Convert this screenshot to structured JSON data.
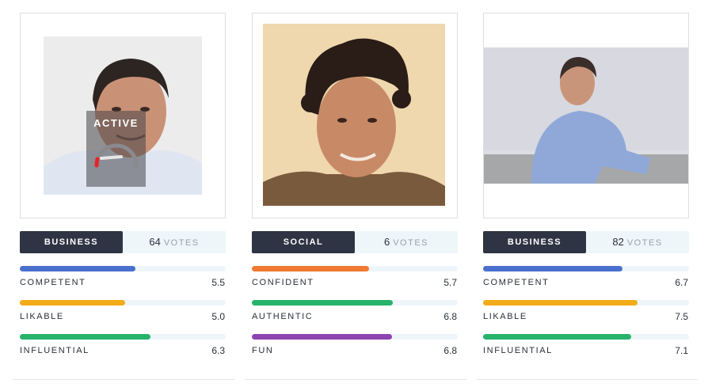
{
  "colors": {
    "badge_bg": "#2f3444",
    "track_bg": "#eef6fa",
    "competent": "#4a6fcf",
    "likable": "#f2ac18",
    "influential": "#27b36b",
    "confident": "#f07a32",
    "authentic": "#27b36b",
    "fun": "#8e44b0",
    "gauge_needle": "#e8232b"
  },
  "cards": [
    {
      "overlay": {
        "label": "ACTIVE",
        "icon": "gauge-icon"
      },
      "category": "BUSINESS",
      "votes_count": "64",
      "votes_label": "VOTES",
      "traits": [
        {
          "name": "COMPETENT",
          "score": "5.5",
          "fraction": 0.56,
          "color": "#4a6fcf"
        },
        {
          "name": "LIKABLE",
          "score": "5.0",
          "fraction": 0.51,
          "color": "#f2ac18"
        },
        {
          "name": "INFLUENTIAL",
          "score": "6.3",
          "fraction": 0.635,
          "color": "#27b36b"
        }
      ]
    },
    {
      "category": "SOCIAL",
      "votes_count": "6",
      "votes_label": "VOTES",
      "traits": [
        {
          "name": "CONFIDENT",
          "score": "5.7",
          "fraction": 0.57,
          "color": "#f07a32"
        },
        {
          "name": "AUTHENTIC",
          "score": "6.8",
          "fraction": 0.685,
          "color": "#27b36b"
        },
        {
          "name": "FUN",
          "score": "6.8",
          "fraction": 0.68,
          "color": "#8e44b0"
        }
      ]
    },
    {
      "category": "BUSINESS",
      "votes_count": "82",
      "votes_label": "VOTES",
      "traits": [
        {
          "name": "COMPETENT",
          "score": "6.7",
          "fraction": 0.675,
          "color": "#4a6fcf"
        },
        {
          "name": "LIKABLE",
          "score": "7.5",
          "fraction": 0.75,
          "color": "#f2ac18"
        },
        {
          "name": "INFLUENTIAL",
          "score": "7.1",
          "fraction": 0.72,
          "color": "#27b36b"
        }
      ]
    }
  ]
}
